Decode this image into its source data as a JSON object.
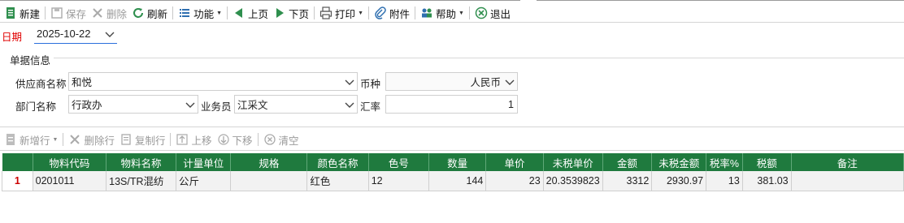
{
  "toolbar": {
    "new": "新建",
    "save": "保存",
    "delete": "删除",
    "refresh": "刷新",
    "functions": "功能",
    "prev": "上页",
    "next": "下页",
    "print": "打印",
    "attachment": "附件",
    "help": "帮助",
    "exit": "退出"
  },
  "date": {
    "label": "日期",
    "value": "2025-10-22"
  },
  "doc_info": {
    "title": "单据信息",
    "supplier_label": "供应商名称",
    "supplier_value": "和悦",
    "currency_label": "币种",
    "currency_value": "人民币",
    "dept_label": "部门名称",
    "dept_value": "行政办",
    "salesman_label": "业务员",
    "salesman_value": "江采文",
    "rate_label": "汇率",
    "rate_value": "1"
  },
  "row_toolbar": {
    "add_row": "新增行",
    "delete_row": "删除行",
    "copy_row": "复制行",
    "move_up": "上移",
    "move_down": "下移",
    "clear": "清空"
  },
  "grid": {
    "columns": [
      "物料代码",
      "物料名称",
      "计量单位",
      "规格",
      "颜色名称",
      "色号",
      "数量",
      "单价",
      "未税单价",
      "金额",
      "未税金额",
      "税率%",
      "税额",
      "备注"
    ],
    "rows": [
      {
        "no": "1",
        "code": "0201011",
        "name": "13S/TR混纺",
        "unit": "公斤",
        "spec": "",
        "color_name": "红色",
        "color_no": "12",
        "qty": "144",
        "price": "23",
        "price_notax": "20.3539823",
        "amount": "3312",
        "amount_notax": "2930.97",
        "tax_rate": "13",
        "tax": "381.03",
        "remark": ""
      }
    ]
  },
  "colors": {
    "header_bg": "#1f7a3e",
    "date_label": "#e00000",
    "focus_underline": "#2a6fdb",
    "row_number": "#cc0000"
  }
}
